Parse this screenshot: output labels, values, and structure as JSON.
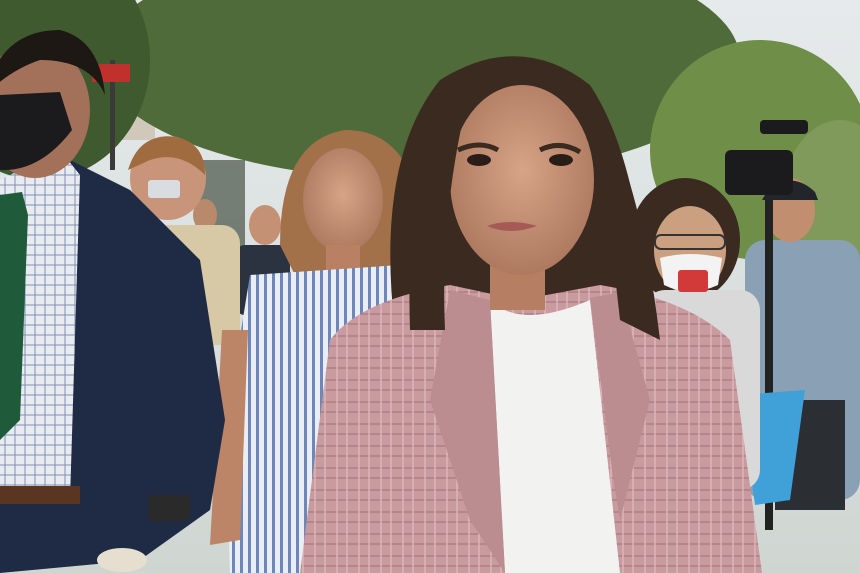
{
  "photo": {
    "kind": "press photograph",
    "palette": {
      "sky": "#dfe4e6",
      "foliage": "#4f6b3a",
      "foliage_light": "#7f9a5a",
      "blazer": "#c99a9e",
      "tshirt": "#f2f2f0",
      "hair": "#3b2a20",
      "skin": "#c99478",
      "navy_suit": "#1f2a44",
      "striped_dress": "#b9c6de",
      "camera": "#1b1b1d"
    }
  }
}
